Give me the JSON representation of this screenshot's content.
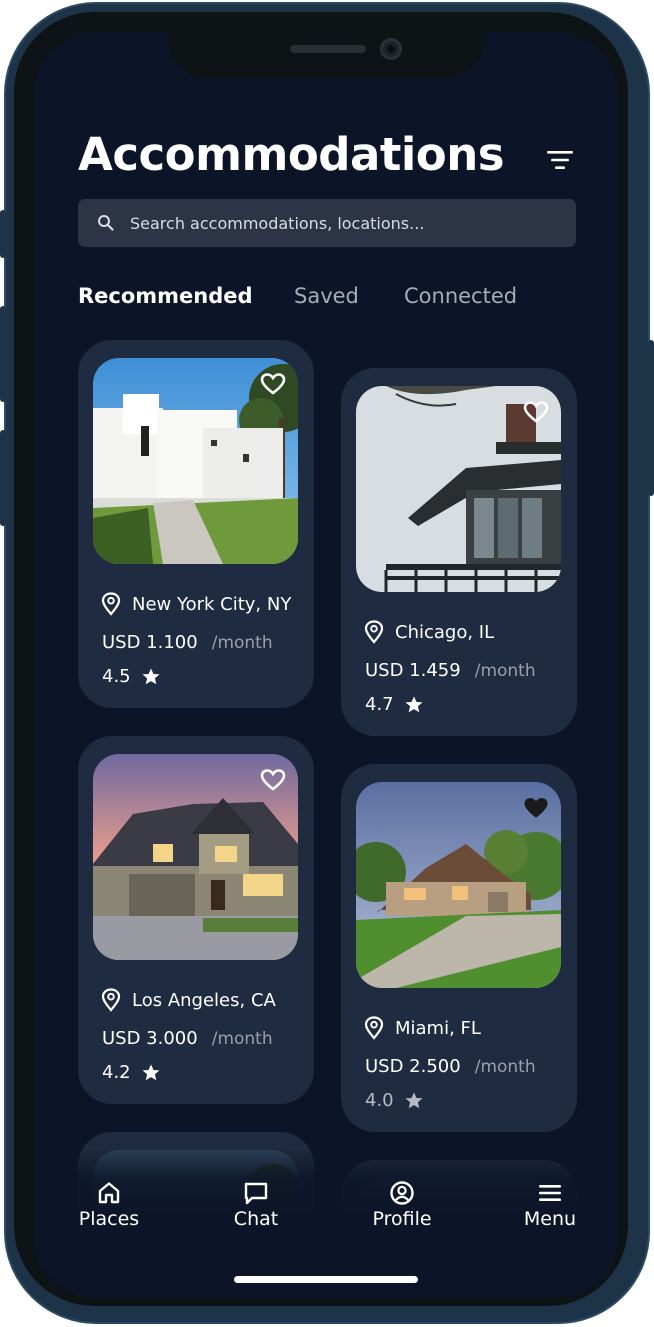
{
  "page": {
    "title": "Accommodations"
  },
  "search": {
    "placeholder": "Search accommodations, locations..."
  },
  "tabs": [
    {
      "label": "Recommended",
      "active": true
    },
    {
      "label": "Saved",
      "active": false
    },
    {
      "label": "Connected",
      "active": false
    }
  ],
  "listings": [
    {
      "location": "New York City, NY",
      "price": "USD 1.100",
      "period": "/month",
      "rating": "4.5",
      "saved": true
    },
    {
      "location": "Chicago, IL",
      "price": "USD 1.459",
      "period": "/month",
      "rating": "4.7",
      "saved": true
    },
    {
      "location": "Los Angeles, CA",
      "price": "USD 3.000",
      "period": "/month",
      "rating": "4.2",
      "saved": true
    },
    {
      "location": "Miami, FL",
      "price": "USD 2.500",
      "period": "/month",
      "rating": "4.0",
      "saved": true
    }
  ],
  "nav": [
    {
      "label": "Places",
      "icon": "home-icon"
    },
    {
      "label": "Chat",
      "icon": "chat-icon"
    },
    {
      "label": "Profile",
      "icon": "profile-icon"
    },
    {
      "label": "Menu",
      "icon": "menu-icon"
    }
  ],
  "colors": {
    "background": "#0c1528",
    "card": "#1f2b40",
    "search": "#2c3446",
    "text": "#ffffff",
    "muted": "#99a0ac"
  }
}
